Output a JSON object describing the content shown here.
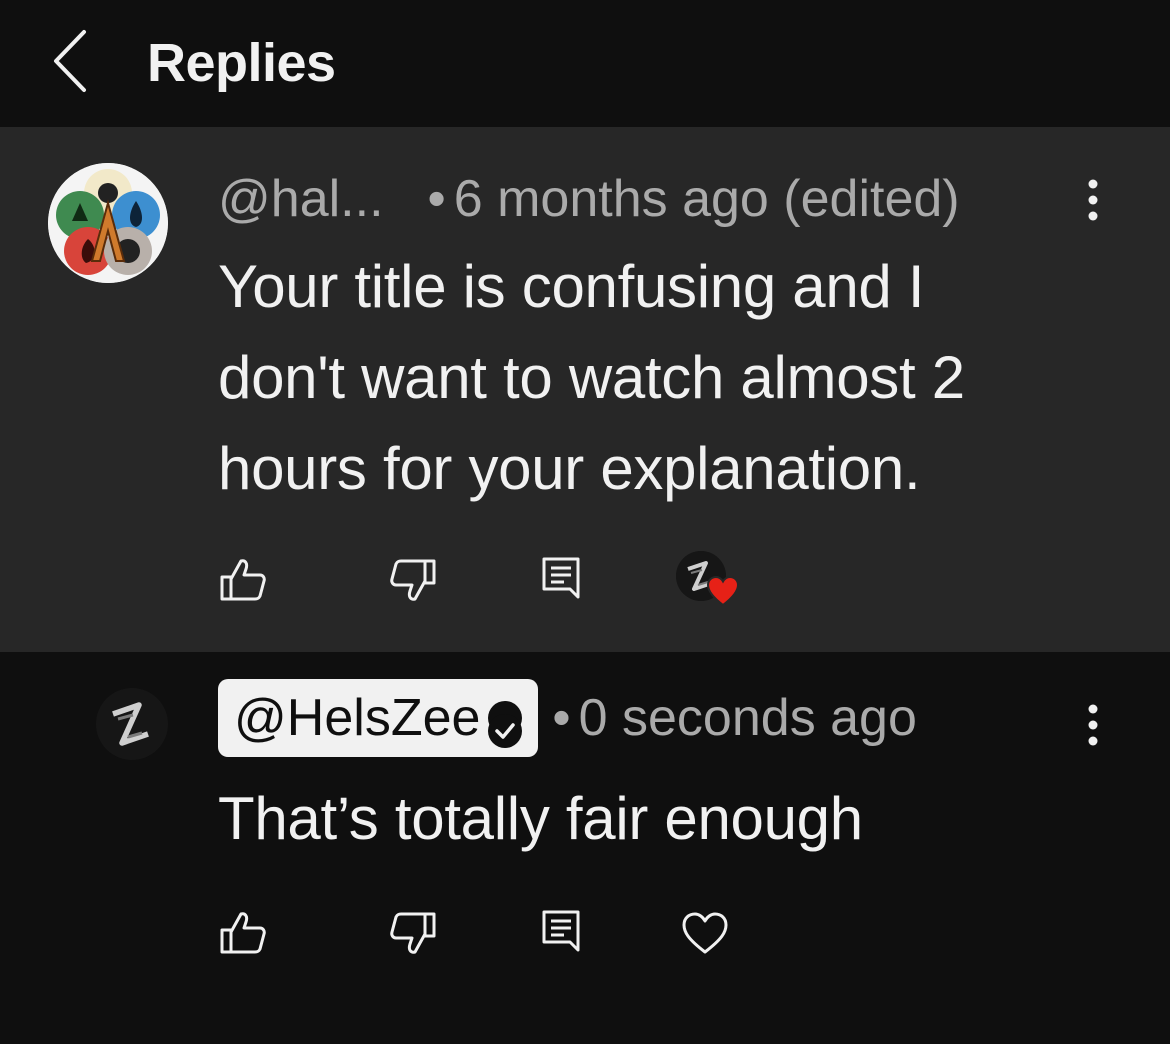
{
  "header": {
    "title": "Replies"
  },
  "parent_comment": {
    "handle": "@hal...",
    "separator": "•",
    "timestamp": "6 months ago (edited)",
    "lines": [
      "Your title is confusing and I",
      "don't want to watch almost 2",
      "hours for your explanation."
    ],
    "hearted_by_creator": true
  },
  "reply": {
    "handle": "@HelsZee",
    "verified": true,
    "separator": "•",
    "timestamp": "0 seconds ago",
    "text": "That’s totally fair enough"
  },
  "colors": {
    "background": "#0f0f0f",
    "highlight": "#272727",
    "primary_text": "#f1f1f1",
    "secondary_text": "#aaaaaa",
    "heart_red": "#e62117"
  },
  "icons": {
    "back": "chevron-left-icon",
    "menu": "kebab-menu-icon",
    "like": "thumbs-up-icon",
    "dislike": "thumbs-down-icon",
    "reply": "reply-comment-icon",
    "heart": "heart-icon",
    "verified": "verified-check-icon"
  }
}
